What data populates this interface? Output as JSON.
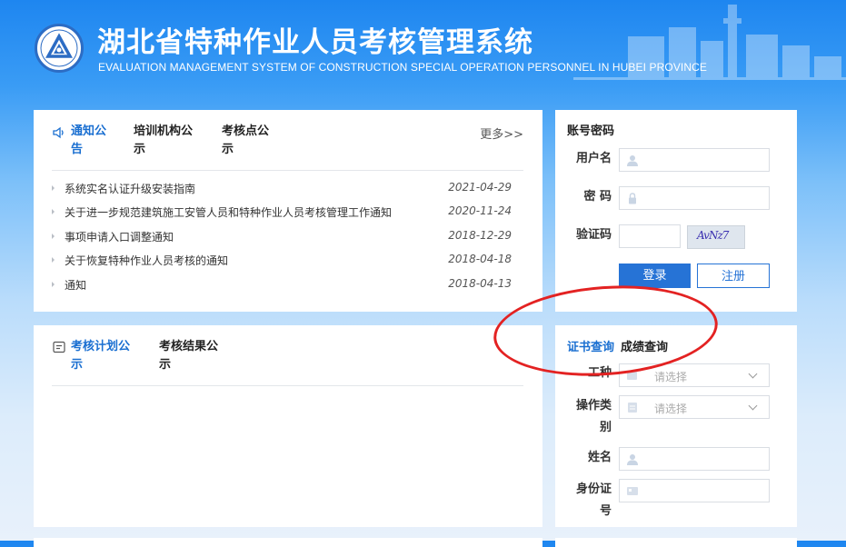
{
  "header": {
    "title": "湖北省特种作业人员考核管理系统",
    "subtitle": "EVALUATION MANAGEMENT SYSTEM OF CONSTRUCTION SPECIAL OPERATION PERSONNEL IN HUBEI PROVINCE"
  },
  "notice": {
    "tabs": [
      "通知公告",
      "培训机构公示",
      "考核点公示"
    ],
    "more": "更多>>",
    "items": [
      {
        "title": "系统实名认证升级安装指南",
        "date": "2021-04-29"
      },
      {
        "title": "关于进一步规范建筑施工安管人员和特种作业人员考核管理工作通知",
        "date": "2020-11-24"
      },
      {
        "title": "事项申请入口调整通知",
        "date": "2018-12-29"
      },
      {
        "title": "关于恢复特种作业人员考核的通知",
        "date": "2018-04-18"
      },
      {
        "title": "通知",
        "date": "2018-04-13"
      }
    ]
  },
  "plan": {
    "tabs": [
      "考核计划公示",
      "考核结果公示"
    ]
  },
  "login": {
    "title": "账号密码",
    "username_label": "用户名",
    "password_label": "密 码",
    "captcha_label": "验证码",
    "captcha_text": "AvNz7",
    "login_button": "登录",
    "register_button": "注册"
  },
  "query": {
    "tabs": [
      "证书查询",
      "成绩查询"
    ],
    "trade_label": "工种",
    "trade_placeholder": "请选择",
    "category_label": "操作类别",
    "category_placeholder": "请选择",
    "name_label": "姓名",
    "id_label": "身份证号"
  },
  "colors": {
    "accent": "#1a6fd1",
    "button": "#2673d6",
    "annotation": "#e32222"
  }
}
